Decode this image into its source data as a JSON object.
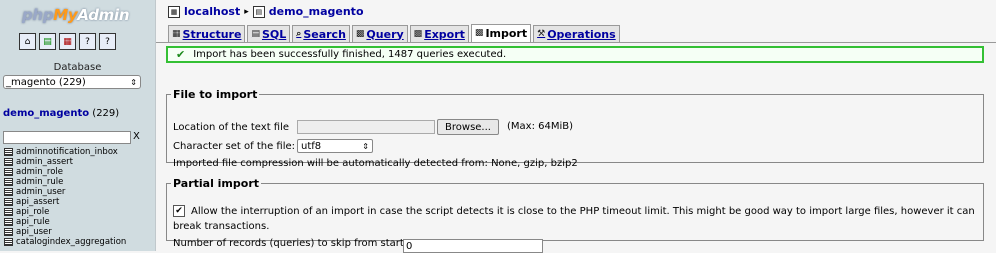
{
  "nav": {
    "logo": {
      "php": "php",
      "my": "My",
      "admin": "Admin"
    },
    "toolbar_icons": [
      "home-icon",
      "sql-window-icon",
      "query-icon",
      "docs-icon",
      "changelog-icon"
    ],
    "db_label": "Database",
    "db_select_value": "_magento (229)",
    "db_name": "demo_magento",
    "db_count": "(229)",
    "filter_clear": "X",
    "tables": [
      "adminnotification_inbox",
      "admin_assert",
      "admin_role",
      "admin_rule",
      "admin_user",
      "api_assert",
      "api_role",
      "api_rule",
      "api_user",
      "catalogindex_aggregation"
    ]
  },
  "breadcrumb": {
    "server": "localhost",
    "database": "demo_magento"
  },
  "tabs": [
    {
      "label": "Structure",
      "icon": "structure-icon",
      "active": false
    },
    {
      "label": "SQL",
      "icon": "sql-icon",
      "active": false
    },
    {
      "label": "Search",
      "icon": "search-icon",
      "active": false
    },
    {
      "label": "Query",
      "icon": "query-icon",
      "active": false
    },
    {
      "label": "Export",
      "icon": "export-icon",
      "active": false
    },
    {
      "label": "Import",
      "icon": "import-icon",
      "active": true
    },
    {
      "label": "Operations",
      "icon": "operations-icon",
      "active": false
    }
  ],
  "notice": {
    "message": "Import has been successfully finished, 1487 queries executed."
  },
  "file_import": {
    "legend": "File to import",
    "location_label": "Location of the text file",
    "browse_label": "Browse...",
    "max_size": "(Max: 64MiB)",
    "charset_label": "Character set of the file:",
    "charset_value": "utf8",
    "compression_note": "Imported file compression will be automatically detected from: None, gzip, bzip2"
  },
  "partial_import": {
    "legend": "Partial import",
    "allow_interrupt_line1": "Allow the interruption of an import in case the script detects it is close to the PHP timeout limit. This might be good way to import large files, however it can",
    "allow_interrupt_line2": "break transactions.",
    "skip_label": "Number of records (queries) to skip from start",
    "skip_value": "0"
  },
  "colors": {
    "nav_bg": "#d0dce0",
    "link": "#0000a0",
    "success_border": "#34c034"
  }
}
